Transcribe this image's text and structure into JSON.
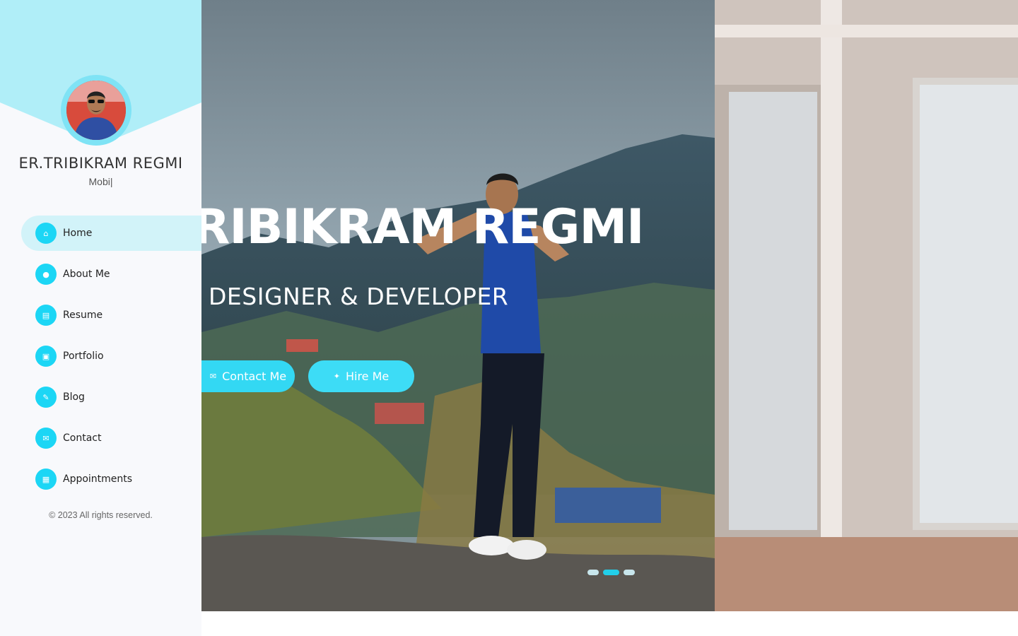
{
  "profile": {
    "name": "ER.TRIBIKRAM REGMI",
    "role": "Mobi|"
  },
  "nav": {
    "items": [
      {
        "label": "Home",
        "icon": "home-icon",
        "active": true
      },
      {
        "label": "About Me",
        "icon": "user-icon",
        "active": false
      },
      {
        "label": "Resume",
        "icon": "file-icon",
        "active": false
      },
      {
        "label": "Portfolio",
        "icon": "briefcase-icon",
        "active": false
      },
      {
        "label": "Blog",
        "icon": "pen-icon",
        "active": false
      },
      {
        "label": "Contact",
        "icon": "envelope-icon",
        "active": false
      },
      {
        "label": "Appointments",
        "icon": "calendar-icon",
        "active": false
      }
    ]
  },
  "footer": {
    "text": "© 2023 All rights reserved."
  },
  "hero": {
    "title": "RIBIKRAM REGMI",
    "subtitle": "DESIGNER & DEVELOPER",
    "contact_label": "Contact Me",
    "hire_label": "Hire Me",
    "slides_total": 3,
    "slide_active": 2
  },
  "colors": {
    "accent": "#1cd6f5",
    "sidebar_top": "#b0eef8",
    "active_nav_bg": "#d2f3f9"
  }
}
